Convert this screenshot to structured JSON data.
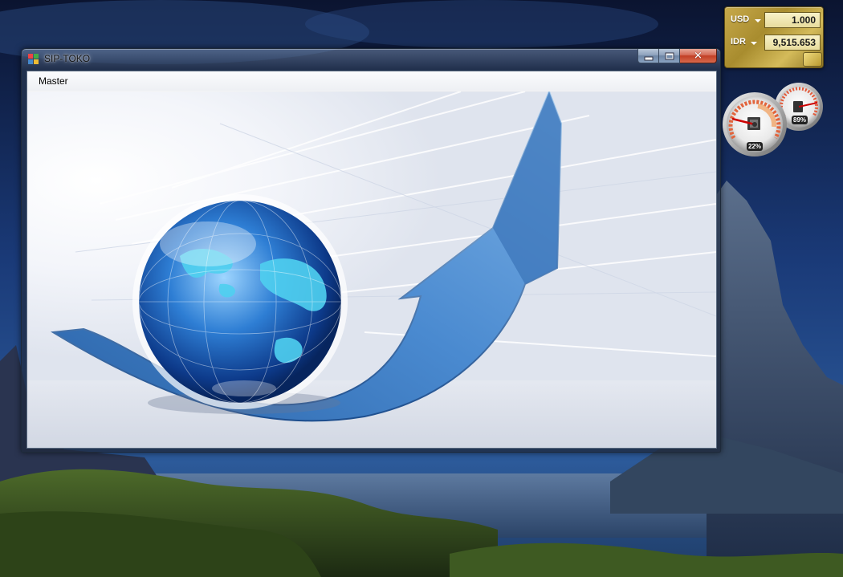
{
  "window": {
    "title": "SIP-TOKO",
    "menu": [
      {
        "label": "Master"
      }
    ]
  },
  "currency_gadget": {
    "rows": [
      {
        "code": "USD",
        "value": "1.000"
      },
      {
        "code": "IDR",
        "value": "9,515.653"
      }
    ]
  },
  "meter_gadget": {
    "cpu_percent_label": "22%",
    "memory_percent_label": "89%",
    "cpu_level": 0.22,
    "memory_level": 0.89
  },
  "colors": {
    "close_button": "#c13e24",
    "gadget_gold": "#c7a94b",
    "arrow_blue": "#3f7fc0"
  }
}
